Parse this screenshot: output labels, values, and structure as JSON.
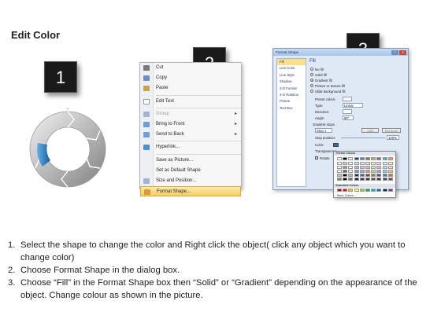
{
  "header": {
    "title": "Edit Color"
  },
  "steps": [
    "1",
    "2",
    "3"
  ],
  "colors": {
    "ring_gray": "#b0b0b0",
    "ring_highlight": "#2d7fc4",
    "menu_highlight": "#f6cf62"
  },
  "context_menu": {
    "items": [
      {
        "label": "Cut",
        "icon": "scissors-icon",
        "color": "#7a7a7a"
      },
      {
        "label": "Copy",
        "icon": "copy-icon",
        "color": "#6f8fc3"
      },
      {
        "label": "Paste",
        "icon": "paste-icon",
        "color": "#c9a34b"
      },
      {
        "label": "Edit Text",
        "icon": "edit-text-icon",
        "color": "#ffffff"
      },
      {
        "label": "Group",
        "icon": "group-icon",
        "color": "#9fb4d3"
      },
      {
        "label": "Bring to Front",
        "icon": "bring-to-front-icon",
        "color": "#6f9fd6"
      },
      {
        "label": "Send to Back",
        "icon": "send-to-back-icon",
        "color": "#6f9fd6"
      },
      {
        "label": "Hyperlink...",
        "icon": "hyperlink-icon",
        "color": "#4f8fcf"
      },
      {
        "label": "Save as Picture...",
        "icon": "",
        "color": "transparent"
      },
      {
        "label": "Set as Default Shape",
        "icon": "",
        "color": "transparent"
      },
      {
        "label": "Size and Position...",
        "icon": "size-position-icon",
        "color": "#9fb4d3"
      },
      {
        "label": "Format Shape...",
        "icon": "format-shape-icon",
        "color": "#d99b3c"
      }
    ]
  },
  "format_dialog": {
    "title": "Format Shape",
    "nav_items": [
      "Fill",
      "Line Color",
      "Line Style",
      "Shadow",
      "3-D Format",
      "3-D Rotation",
      "Picture",
      "Text Box"
    ],
    "fill_heading": "Fill",
    "fill_options": [
      "No fill",
      "Solid fill",
      "Gradient fill",
      "Picture or texture fill",
      "Slide background fill"
    ],
    "labels": {
      "preset_colors": "Preset colors:",
      "type": "Type:",
      "type_value": "Linear",
      "direction": "Direction:",
      "angle": "Angle:",
      "angle_value": "90°",
      "gradient_stops": "Gradient stops",
      "stop_value": "Stop 1",
      "add": "Add",
      "remove": "Remove",
      "stop_position": "Stop position:",
      "stop_position_value": "100%",
      "color": "Color:",
      "transparency": "Transparency:",
      "rotate": "Rotate"
    }
  },
  "color_picker": {
    "theme_label": "Theme Colors",
    "standard_label": "Standard Colors",
    "more_label": "More Colors...",
    "theme_row": [
      "#ffffff",
      "#000000",
      "#eeece1",
      "#1f497d",
      "#4f81bd",
      "#c0504d",
      "#9bbb59",
      "#8064a2",
      "#4bacc6",
      "#f79646"
    ],
    "standard_row": [
      "#c00000",
      "#ff0000",
      "#ffc000",
      "#ffff00",
      "#92d050",
      "#00b050",
      "#00b0f0",
      "#0070c0",
      "#002060",
      "#7030a0"
    ]
  },
  "instructions": [
    {
      "num": "1.",
      "text": "Select the shape to change the color and Right click the object( click any object which you want to change color)"
    },
    {
      "num": "2.",
      "text": "Choose Format Shape in the dialog box."
    },
    {
      "num": "3.",
      "text": "Choose “Fill” in the Format Shape box then “Solid” or “Gradient” depending on the appearance of the object. Change colour as shown in the picture."
    }
  ]
}
